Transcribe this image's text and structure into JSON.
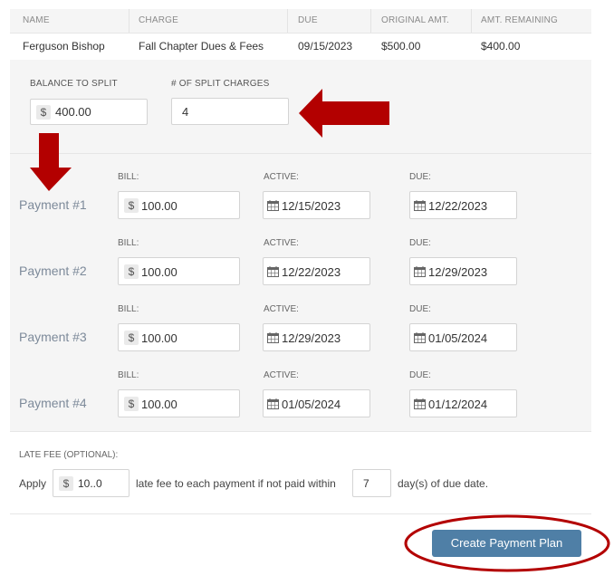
{
  "table": {
    "headers": [
      "NAME",
      "CHARGE",
      "DUE",
      "ORIGINAL AMT.",
      "AMT. REMAINING"
    ],
    "row": {
      "name": "Ferguson Bishop",
      "charge": "Fall Chapter Dues & Fees",
      "due": "09/15/2023",
      "original_amt": "$500.00",
      "amt_remaining": "$400.00"
    }
  },
  "split": {
    "balance_label": "BALANCE TO SPLIT",
    "balance_currency": "$",
    "balance_value": "400.00",
    "count_label": "# OF SPLIT CHARGES",
    "count_value": "4"
  },
  "payments": {
    "col_bill": "BILL:",
    "col_active": "ACTIVE:",
    "col_due": "DUE:",
    "items": [
      {
        "label": "Payment #1",
        "currency": "$",
        "bill": "100.00",
        "active": "12/15/2023",
        "due": "12/22/2023"
      },
      {
        "label": "Payment #2",
        "currency": "$",
        "bill": "100.00",
        "active": "12/22/2023",
        "due": "12/29/2023"
      },
      {
        "label": "Payment #3",
        "currency": "$",
        "bill": "100.00",
        "active": "12/29/2023",
        "due": "01/05/2024"
      },
      {
        "label": "Payment #4",
        "currency": "$",
        "bill": "100.00",
        "active": "01/05/2024",
        "due": "01/12/2024"
      }
    ]
  },
  "late_fee": {
    "label": "LATE FEE (OPTIONAL):",
    "apply": "Apply",
    "currency": "$",
    "amount": "10..0",
    "middle_text": "late fee to each payment if not paid within",
    "days": "7",
    "suffix": "day(s) of due date."
  },
  "actions": {
    "create_label": "Create Payment Plan"
  },
  "colors": {
    "annotation_red": "#b30000",
    "button_blue": "#4f7fa6",
    "panel_gray": "#f5f5f5"
  }
}
